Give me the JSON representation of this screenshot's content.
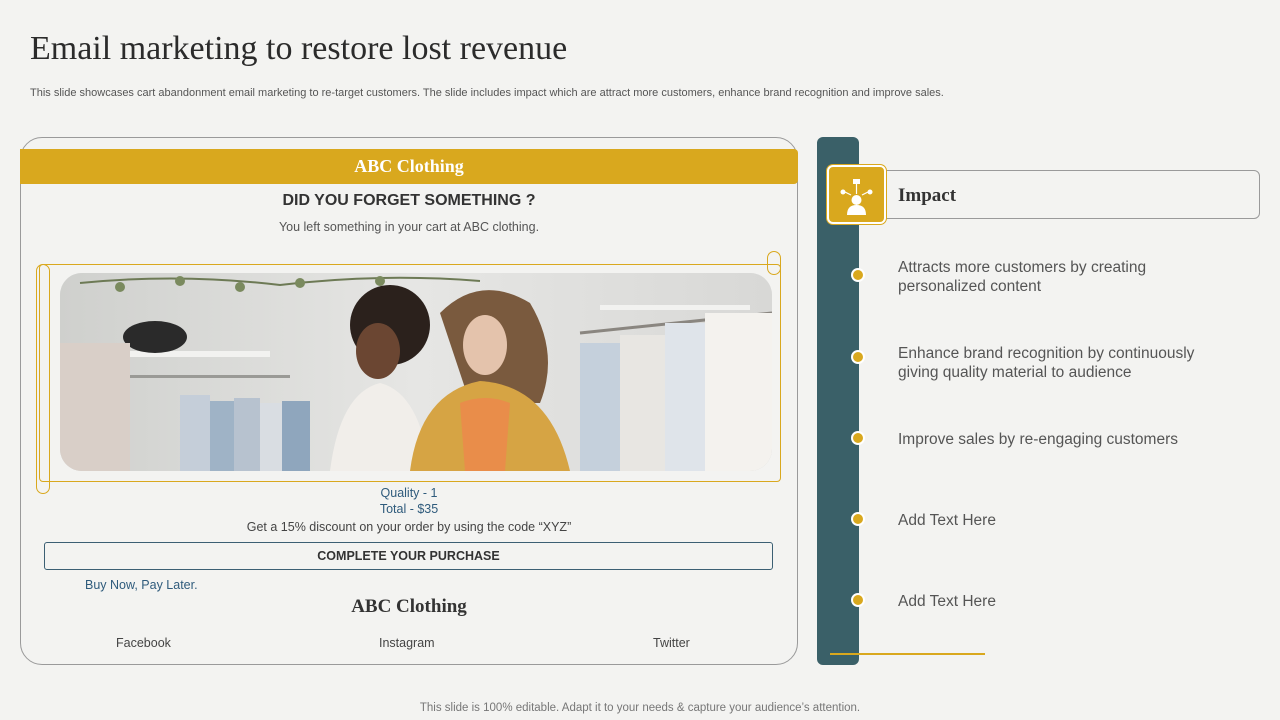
{
  "slide": {
    "title": "Email marketing to restore lost revenue",
    "subtitle": "This slide showcases cart abandonment email marketing to re-target customers. The slide includes impact which are attract more customers, enhance brand recognition and improve sales.",
    "footer_note": "This slide is 100% editable. Adapt it to your needs & capture your audience’s attention."
  },
  "email": {
    "brand_header": "ABC Clothing",
    "headline": "DID YOU FORGET SOMETHING ?",
    "message": "You left something in your cart at ABC clothing.",
    "quantity": "Quality - 1",
    "total": "Total - $35",
    "discount": "Get a 15% discount on your order by using the code “XYZ”",
    "cta_label": "COMPLETE YOUR PURCHASE",
    "bnpl": "Buy Now, Pay Later.",
    "footer_brand": "ABC Clothing",
    "social": [
      "Facebook",
      "Instagram",
      "Twitter"
    ]
  },
  "impact": {
    "label": "Impact",
    "icon": "presenter-network-icon",
    "points": [
      "Attracts more customers by creating personalized content",
      "Enhance brand recognition by continuously giving quality material to audience",
      "Improve sales by re-engaging customers",
      "Add Text Here",
      "Add Text Here"
    ]
  },
  "colors": {
    "accent": "#d9a81e",
    "rail": "#3a6068",
    "link": "#2f5b7c"
  }
}
